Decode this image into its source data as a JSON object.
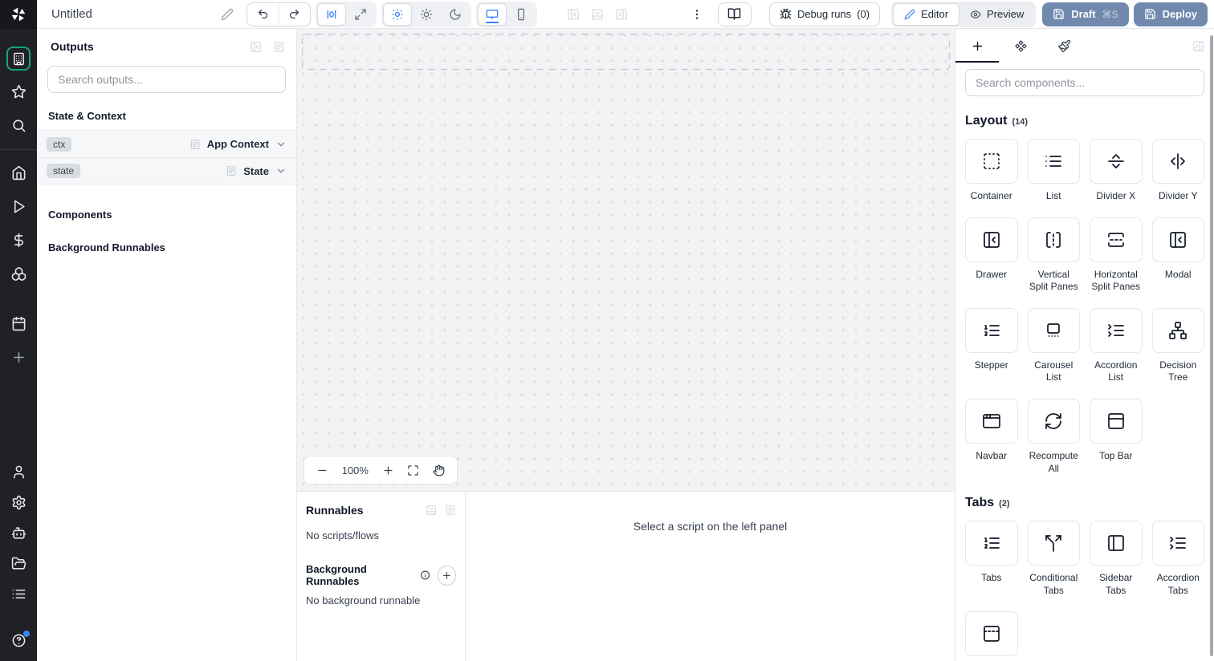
{
  "topbar": {
    "title": "Untitled",
    "debug_runs_label": "Debug runs",
    "debug_runs_count": "(0)",
    "editor_label": "Editor",
    "preview_label": "Preview",
    "draft_label": "Draft",
    "draft_shortcut": "⌘S",
    "deploy_label": "Deploy",
    "icons": [
      "windmill-logo",
      "edit-pencil",
      "undo",
      "redo",
      "zero-width",
      "maximize",
      "theme-auto",
      "theme-light",
      "theme-dark",
      "desktop",
      "mobile",
      "panel-left-close",
      "panel-bottom-close",
      "panel-right-close",
      "kebab-menu",
      "book-open",
      "bug",
      "pencil",
      "eye",
      "save"
    ]
  },
  "rail": {
    "icons": [
      "building-workspace",
      "star-favorites",
      "search",
      "home",
      "play-runs",
      "dollar-usage",
      "boxes-resources",
      "calendar-schedules",
      "plus-create",
      "user",
      "settings-gear",
      "bot-workers",
      "folder-open",
      "list-logs",
      "help-circle"
    ],
    "help_has_notification_dot": true
  },
  "outputs_panel": {
    "title": "Outputs",
    "search_placeholder": "Search outputs...",
    "state_context_header": "State & Context",
    "components_header": "Components",
    "background_header": "Background Runnables",
    "rows": [
      {
        "badge": "ctx",
        "type": "App Context"
      },
      {
        "badge": "state",
        "type": "State"
      }
    ]
  },
  "canvas": {
    "zoom_level": "100%"
  },
  "bottom_panel": {
    "runnables_title": "Runnables",
    "no_scripts": "No scripts/flows",
    "background_title": "Background Runnables",
    "no_background": "No background runnable",
    "select_hint": "Select a script on the left panel"
  },
  "components_panel": {
    "search_placeholder": "Search components...",
    "sections": [
      {
        "title": "Layout",
        "count": "(14)",
        "tiles": [
          {
            "label": "Container",
            "icon": "box-select-icon"
          },
          {
            "label": "List",
            "icon": "list-icon"
          },
          {
            "label": "Divider X",
            "icon": "separator-horizontal-icon"
          },
          {
            "label": "Divider Y",
            "icon": "separator-vertical-icon"
          },
          {
            "label": "Drawer",
            "icon": "panel-left-close-icon"
          },
          {
            "label": "Vertical Split Panes",
            "icon": "vertical-split-icon"
          },
          {
            "label": "Horizontal Split Panes",
            "icon": "horizontal-split-icon"
          },
          {
            "label": "Modal",
            "icon": "panel-left-close-icon"
          },
          {
            "label": "Stepper",
            "icon": "list-ordered-icon"
          },
          {
            "label": "Carousel List",
            "icon": "carousel-icon"
          },
          {
            "label": "Accordion List",
            "icon": "list-collapse-icon"
          },
          {
            "label": "Decision Tree",
            "icon": "network-icon"
          },
          {
            "label": "Navbar",
            "icon": "app-window-icon"
          },
          {
            "label": "Recompute All",
            "icon": "refresh-icon"
          },
          {
            "label": "Top Bar",
            "icon": "panel-top-icon"
          }
        ]
      },
      {
        "title": "Tabs",
        "count": "(2)",
        "tiles": [
          {
            "label": "Tabs",
            "icon": "list-ordered-icon"
          },
          {
            "label": "Conditional Tabs",
            "icon": "split-icon"
          },
          {
            "label": "Sidebar Tabs",
            "icon": "panel-left-icon"
          },
          {
            "label": "Accordion Tabs",
            "icon": "list-collapse-icon"
          },
          {
            "label": "",
            "icon": "panel-top-dashed-icon"
          }
        ]
      }
    ]
  },
  "colors": {
    "accent_blue": "#3b82f6",
    "workspace_green": "#15a672",
    "primary_button": "#7189ac",
    "sidebar_bg": "#1f2127",
    "canvas_bg": "#f2f3f5"
  }
}
